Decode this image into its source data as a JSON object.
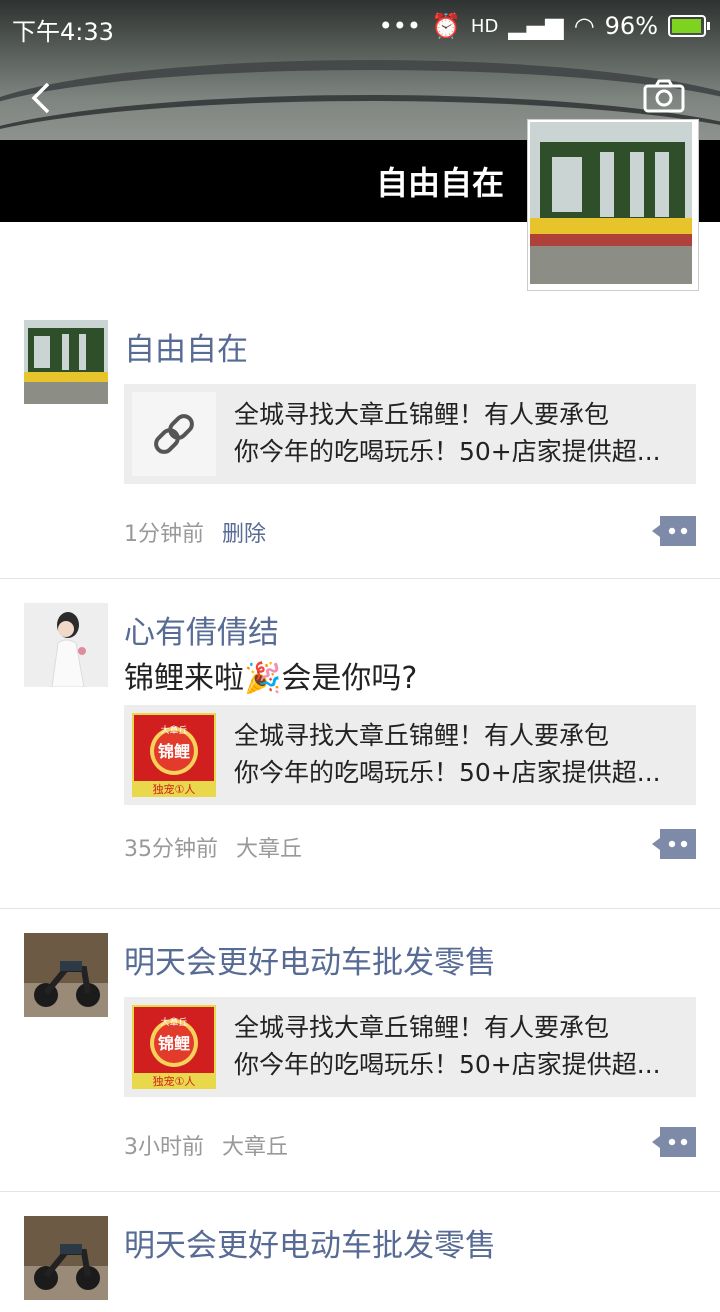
{
  "status_bar": {
    "time": "下午4:33",
    "battery": "96%",
    "network": "HD",
    "battery_level": 0.96
  },
  "header": {
    "back_icon": "back-chevron-icon",
    "camera_icon": "camera-icon",
    "profile_name": "自由自在"
  },
  "posts": [
    {
      "name": "自由自在",
      "text": "",
      "link": {
        "line1": "全城寻找大章丘锦鲤！有人要承包",
        "line2": "你今年的吃喝玩乐！50+店家提供超...",
        "thumb": "link-icon"
      },
      "time": "1分钟前",
      "extra": "删除",
      "extra_type": "delete"
    },
    {
      "name": "心有倩倩结",
      "text": "锦鲤来啦🎉会是你吗?",
      "link": {
        "line1": "全城寻找大章丘锦鲤！有人要承包",
        "line2": "你今年的吃喝玩乐！50+店家提供超...",
        "thumb": "koi-poster",
        "poster_top": "大章丘",
        "poster_main": "锦鲤",
        "poster_bottom": "独宠①人"
      },
      "time": "35分钟前",
      "extra": "大章丘",
      "extra_type": "location"
    },
    {
      "name": "明天会更好电动车批发零售",
      "text": "",
      "link": {
        "line1": "全城寻找大章丘锦鲤！有人要承包",
        "line2": "你今年的吃喝玩乐！50+店家提供超...",
        "thumb": "koi-poster",
        "poster_top": "大章丘",
        "poster_main": "锦鲤",
        "poster_bottom": "独宠①人"
      },
      "time": "3小时前",
      "extra": "大章丘",
      "extra_type": "location"
    },
    {
      "name": "明天会更好电动车批发零售"
    }
  ],
  "colors": {
    "name_blue": "#576b95",
    "meta_grey": "#999999",
    "card_bg": "#ededed",
    "accent": "#7d8aa8"
  }
}
